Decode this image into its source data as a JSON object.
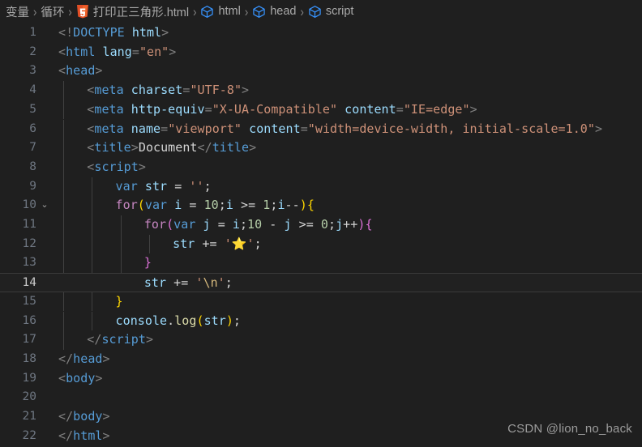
{
  "breadcrumb": {
    "items": [
      {
        "label": "变量",
        "icon": null
      },
      {
        "label": "循环",
        "icon": null
      },
      {
        "label": "打印正三角形.html",
        "icon": "html5-icon"
      },
      {
        "label": "html",
        "icon": "symbol-module-icon"
      },
      {
        "label": "head",
        "icon": "symbol-module-icon"
      },
      {
        "label": "script",
        "icon": "symbol-module-icon"
      }
    ],
    "separator": "›"
  },
  "editor": {
    "language": "html",
    "current_line": 14,
    "fold_marker_line": 10,
    "fold_marker_glyph": "⌄",
    "colors": {
      "background": "#1f1f1f",
      "current_line_background": "#212121",
      "line_number": "#6e7681",
      "line_number_active": "#cccccc",
      "indent_guide": "#404040",
      "tag": "#569cd6",
      "attribute": "#9cdcfe",
      "string": "#ce9178",
      "keyword": "#569cd6",
      "control": "#c586c0",
      "number": "#b5cea8",
      "function": "#dcdcaa",
      "bracket_1": "#ffd700",
      "bracket_2": "#da70d6",
      "bracket_3": "#179fff",
      "punctuation": "#808080",
      "text": "#d4d4d4",
      "escape": "#d7ba7d"
    },
    "lines": [
      {
        "n": 1,
        "indent": 0,
        "tokens": [
          {
            "c": "punct",
            "t": "<!"
          },
          {
            "c": "tag",
            "t": "DOCTYPE"
          },
          {
            "c": "txt",
            "t": " "
          },
          {
            "c": "attr",
            "t": "html"
          },
          {
            "c": "punct",
            "t": ">"
          }
        ]
      },
      {
        "n": 2,
        "indent": 0,
        "tokens": [
          {
            "c": "punct",
            "t": "<"
          },
          {
            "c": "tag",
            "t": "html"
          },
          {
            "c": "txt",
            "t": " "
          },
          {
            "c": "attr",
            "t": "lang"
          },
          {
            "c": "punct",
            "t": "="
          },
          {
            "c": "str",
            "t": "\"en\""
          },
          {
            "c": "punct",
            "t": ">"
          }
        ]
      },
      {
        "n": 3,
        "indent": 0,
        "tokens": [
          {
            "c": "punct",
            "t": "<"
          },
          {
            "c": "tag",
            "t": "head"
          },
          {
            "c": "punct",
            "t": ">"
          }
        ]
      },
      {
        "n": 4,
        "indent": 1,
        "tokens": [
          {
            "c": "punct",
            "t": "<"
          },
          {
            "c": "tag",
            "t": "meta"
          },
          {
            "c": "txt",
            "t": " "
          },
          {
            "c": "attr",
            "t": "charset"
          },
          {
            "c": "punct",
            "t": "="
          },
          {
            "c": "str",
            "t": "\"UTF-8\""
          },
          {
            "c": "punct",
            "t": ">"
          }
        ]
      },
      {
        "n": 5,
        "indent": 1,
        "tokens": [
          {
            "c": "punct",
            "t": "<"
          },
          {
            "c": "tag",
            "t": "meta"
          },
          {
            "c": "txt",
            "t": " "
          },
          {
            "c": "attr",
            "t": "http-equiv"
          },
          {
            "c": "punct",
            "t": "="
          },
          {
            "c": "str",
            "t": "\"X-UA-Compatible\""
          },
          {
            "c": "txt",
            "t": " "
          },
          {
            "c": "attr",
            "t": "content"
          },
          {
            "c": "punct",
            "t": "="
          },
          {
            "c": "str",
            "t": "\"IE=edge\""
          },
          {
            "c": "punct",
            "t": ">"
          }
        ]
      },
      {
        "n": 6,
        "indent": 1,
        "tokens": [
          {
            "c": "punct",
            "t": "<"
          },
          {
            "c": "tag",
            "t": "meta"
          },
          {
            "c": "txt",
            "t": " "
          },
          {
            "c": "attr",
            "t": "name"
          },
          {
            "c": "punct",
            "t": "="
          },
          {
            "c": "str",
            "t": "\"viewport\""
          },
          {
            "c": "txt",
            "t": " "
          },
          {
            "c": "attr",
            "t": "content"
          },
          {
            "c": "punct",
            "t": "="
          },
          {
            "c": "str",
            "t": "\"width=device-width, initial-scale=1.0\""
          },
          {
            "c": "punct",
            "t": ">"
          }
        ]
      },
      {
        "n": 7,
        "indent": 1,
        "tokens": [
          {
            "c": "punct",
            "t": "<"
          },
          {
            "c": "tag",
            "t": "title"
          },
          {
            "c": "punct",
            "t": ">"
          },
          {
            "c": "txt",
            "t": "Document"
          },
          {
            "c": "punct",
            "t": "</"
          },
          {
            "c": "tag",
            "t": "title"
          },
          {
            "c": "punct",
            "t": ">"
          }
        ]
      },
      {
        "n": 8,
        "indent": 1,
        "tokens": [
          {
            "c": "punct",
            "t": "<"
          },
          {
            "c": "tag",
            "t": "script"
          },
          {
            "c": "punct",
            "t": ">"
          }
        ]
      },
      {
        "n": 9,
        "indent": 2,
        "tokens": [
          {
            "c": "kw",
            "t": "var"
          },
          {
            "c": "txt",
            "t": " "
          },
          {
            "c": "var",
            "t": "str"
          },
          {
            "c": "op",
            "t": " = "
          },
          {
            "c": "str",
            "t": "''"
          },
          {
            "c": "op",
            "t": ";"
          }
        ]
      },
      {
        "n": 10,
        "indent": 2,
        "tokens": [
          {
            "c": "ctrl",
            "t": "for"
          },
          {
            "c": "b1",
            "t": "("
          },
          {
            "c": "kw",
            "t": "var"
          },
          {
            "c": "txt",
            "t": " "
          },
          {
            "c": "var",
            "t": "i"
          },
          {
            "c": "op",
            "t": " = "
          },
          {
            "c": "num",
            "t": "10"
          },
          {
            "c": "op",
            "t": ";"
          },
          {
            "c": "var",
            "t": "i"
          },
          {
            "c": "op",
            "t": " >= "
          },
          {
            "c": "num",
            "t": "1"
          },
          {
            "c": "op",
            "t": ";"
          },
          {
            "c": "var",
            "t": "i"
          },
          {
            "c": "op",
            "t": "--"
          },
          {
            "c": "b1",
            "t": ")"
          },
          {
            "c": "b1",
            "t": "{"
          }
        ]
      },
      {
        "n": 11,
        "indent": 3,
        "tokens": [
          {
            "c": "ctrl",
            "t": "for"
          },
          {
            "c": "b2",
            "t": "("
          },
          {
            "c": "kw",
            "t": "var"
          },
          {
            "c": "txt",
            "t": " "
          },
          {
            "c": "var",
            "t": "j"
          },
          {
            "c": "op",
            "t": " = "
          },
          {
            "c": "var",
            "t": "i"
          },
          {
            "c": "op",
            "t": ";"
          },
          {
            "c": "num",
            "t": "10"
          },
          {
            "c": "op",
            "t": " - "
          },
          {
            "c": "var",
            "t": "j"
          },
          {
            "c": "op",
            "t": " >= "
          },
          {
            "c": "num",
            "t": "0"
          },
          {
            "c": "op",
            "t": ";"
          },
          {
            "c": "var",
            "t": "j"
          },
          {
            "c": "op",
            "t": "++"
          },
          {
            "c": "b2",
            "t": ")"
          },
          {
            "c": "b2",
            "t": "{"
          }
        ]
      },
      {
        "n": 12,
        "indent": 4,
        "tokens": [
          {
            "c": "var",
            "t": "str"
          },
          {
            "c": "op",
            "t": " += "
          },
          {
            "c": "str",
            "t": "'"
          },
          {
            "c": "emoji",
            "t": "⭐"
          },
          {
            "c": "str",
            "t": "'"
          },
          {
            "c": "op",
            "t": ";"
          }
        ]
      },
      {
        "n": 13,
        "indent": 3,
        "tokens": [
          {
            "c": "b2",
            "t": "}"
          }
        ]
      },
      {
        "n": 14,
        "indent": 3,
        "tokens": [
          {
            "c": "var",
            "t": "str"
          },
          {
            "c": "op",
            "t": " += "
          },
          {
            "c": "str",
            "t": "'"
          },
          {
            "c": "esc",
            "t": "\\n"
          },
          {
            "c": "str",
            "t": "'"
          },
          {
            "c": "op",
            "t": ";"
          }
        ]
      },
      {
        "n": 15,
        "indent": 2,
        "tokens": [
          {
            "c": "b1",
            "t": "}"
          }
        ]
      },
      {
        "n": 16,
        "indent": 2,
        "tokens": [
          {
            "c": "var",
            "t": "console"
          },
          {
            "c": "op",
            "t": "."
          },
          {
            "c": "fn",
            "t": "log"
          },
          {
            "c": "b1",
            "t": "("
          },
          {
            "c": "var",
            "t": "str"
          },
          {
            "c": "b1",
            "t": ")"
          },
          {
            "c": "op",
            "t": ";"
          }
        ]
      },
      {
        "n": 17,
        "indent": 1,
        "tokens": [
          {
            "c": "punct",
            "t": "</"
          },
          {
            "c": "tag",
            "t": "script"
          },
          {
            "c": "punct",
            "t": ">"
          }
        ]
      },
      {
        "n": 18,
        "indent": 0,
        "tokens": [
          {
            "c": "punct",
            "t": "</"
          },
          {
            "c": "tag",
            "t": "head"
          },
          {
            "c": "punct",
            "t": ">"
          }
        ]
      },
      {
        "n": 19,
        "indent": 0,
        "tokens": [
          {
            "c": "punct",
            "t": "<"
          },
          {
            "c": "tag",
            "t": "body"
          },
          {
            "c": "punct",
            "t": ">"
          }
        ]
      },
      {
        "n": 20,
        "indent": 0,
        "tokens": []
      },
      {
        "n": 21,
        "indent": 0,
        "tokens": [
          {
            "c": "punct",
            "t": "</"
          },
          {
            "c": "tag",
            "t": "body"
          },
          {
            "c": "punct",
            "t": ">"
          }
        ]
      },
      {
        "n": 22,
        "indent": 0,
        "tokens": [
          {
            "c": "punct",
            "t": "</"
          },
          {
            "c": "tag",
            "t": "html"
          },
          {
            "c": "punct",
            "t": ">"
          }
        ]
      }
    ]
  },
  "watermark": {
    "text": "CSDN @lion_no_back"
  }
}
